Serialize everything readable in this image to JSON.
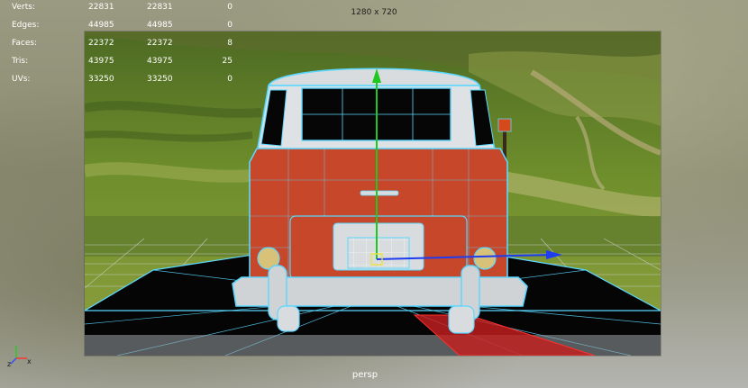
{
  "stats": [
    {
      "label": "Verts:",
      "v1": "22831",
      "v2": "22831",
      "v3": "0"
    },
    {
      "label": "Edges:",
      "v1": "44985",
      "v2": "44985",
      "v3": "0"
    },
    {
      "label": "Faces:",
      "v1": "22372",
      "v2": "22372",
      "v3": "8"
    },
    {
      "label": "Tris:",
      "v1": "43975",
      "v2": "43975",
      "v3": "25"
    },
    {
      "label": "UVs:",
      "v1": "33250",
      "v2": "33250",
      "v3": "0"
    }
  ],
  "viewport": {
    "resolution": "1280 x 720",
    "camera": "persp"
  },
  "gizmo": {
    "axis_x": "x",
    "axis_z": "z"
  },
  "colors": {
    "wireframe": "#5ad7ff",
    "body_paint": "#c7472a",
    "manipulator_y": "#1ec81e",
    "manipulator_x": "#1e3cf0",
    "selection_red": "#e02020"
  }
}
